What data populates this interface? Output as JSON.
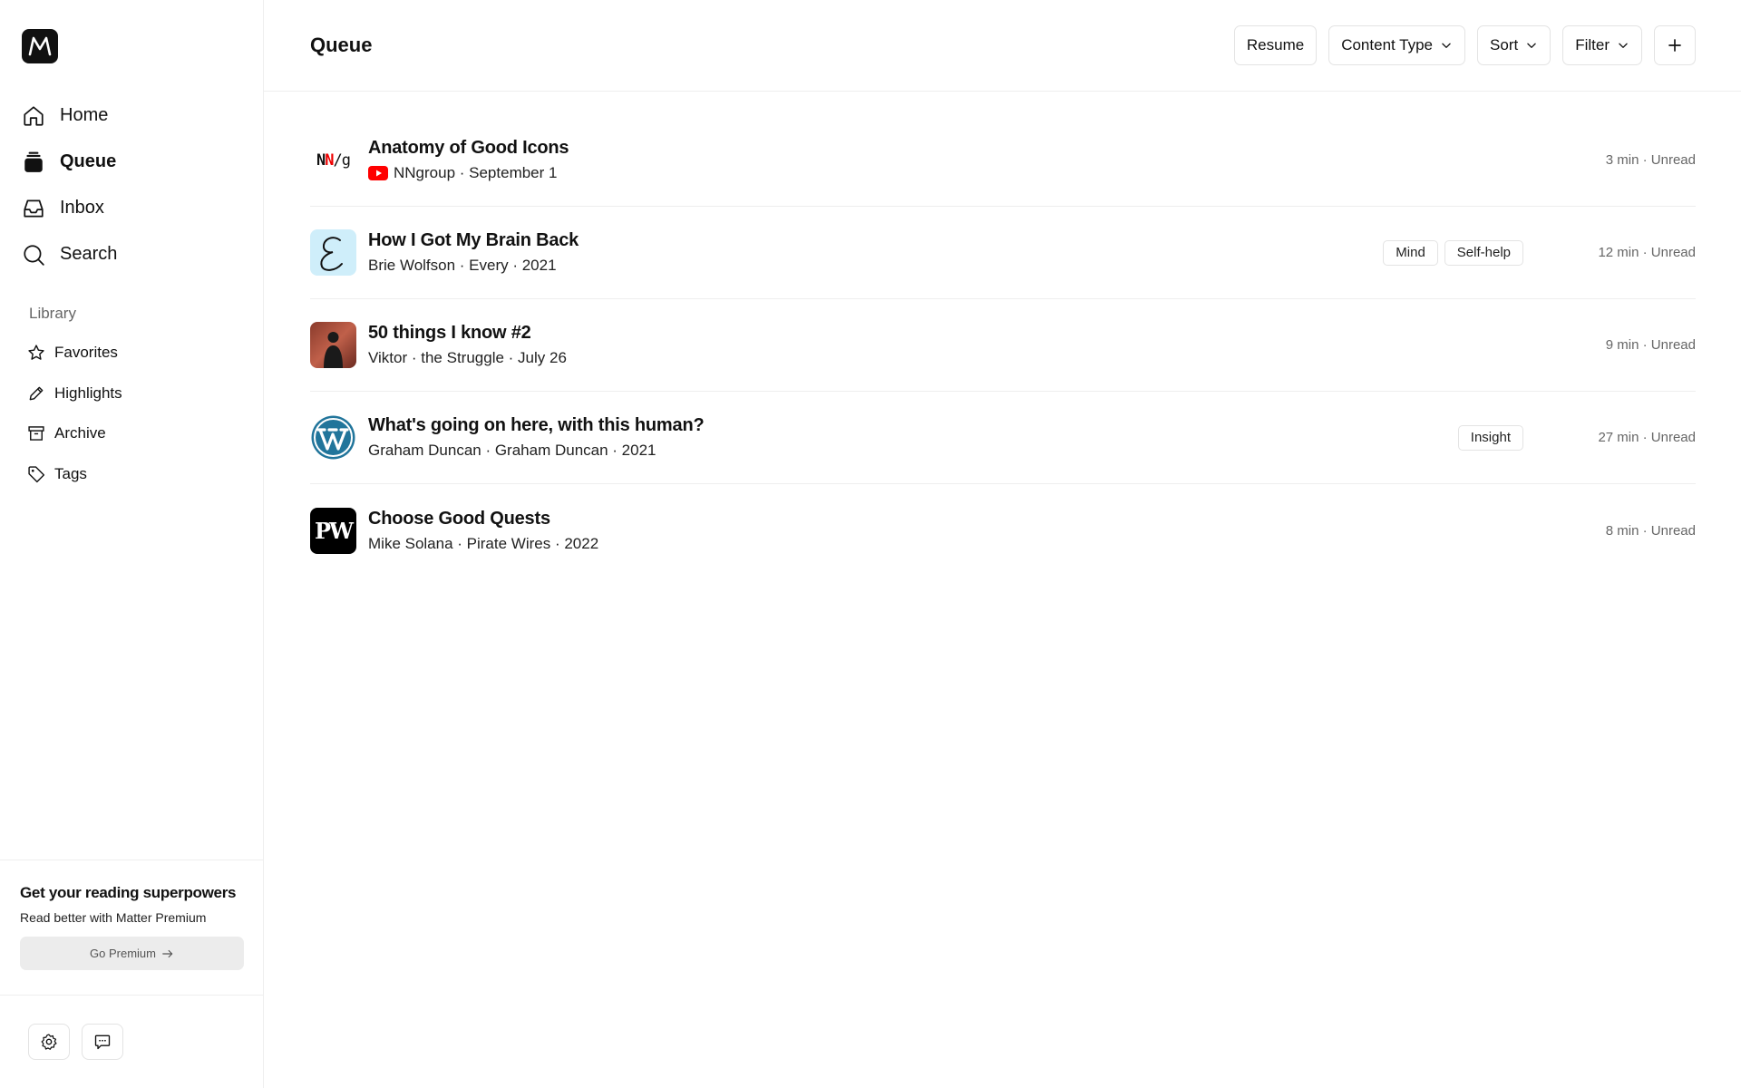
{
  "sidebar": {
    "nav": [
      {
        "label": "Home",
        "icon": "home-icon"
      },
      {
        "label": "Queue",
        "icon": "queue-icon",
        "active": true
      },
      {
        "label": "Inbox",
        "icon": "inbox-icon"
      },
      {
        "label": "Search",
        "icon": "search-icon"
      }
    ],
    "library_title": "Library",
    "library": [
      {
        "label": "Favorites",
        "icon": "star-icon"
      },
      {
        "label": "Highlights",
        "icon": "pencil-icon"
      },
      {
        "label": "Archive",
        "icon": "archive-icon"
      },
      {
        "label": "Tags",
        "icon": "tag-icon"
      }
    ],
    "promo": {
      "title": "Get your reading superpowers",
      "subtitle": "Read better with Matter Premium",
      "button": "Go Premium"
    }
  },
  "header": {
    "title": "Queue",
    "resume": "Resume",
    "content_type": "Content Type",
    "sort": "Sort",
    "filter": "Filter"
  },
  "items": [
    {
      "title": "Anatomy of Good Icons",
      "meta": "NNgroup · September 1",
      "tags": [],
      "status": "3 min · Unread"
    },
    {
      "title": "How I Got My Brain Back",
      "meta": "Brie Wolfson · Every · 2021",
      "tags": [
        "Mind",
        "Self-help"
      ],
      "status": "12 min · Unread"
    },
    {
      "title": "50 things I know #2",
      "meta": "Viktor · the Struggle · July 26",
      "tags": [],
      "status": "9 min · Unread"
    },
    {
      "title": "What's going on here, with this human?",
      "meta": "Graham Duncan · Graham Duncan · 2021",
      "tags": [
        "Insight"
      ],
      "status": "27 min · Unread"
    },
    {
      "title": "Choose Good Quests",
      "meta": "Mike Solana · Pirate Wires · 2022",
      "tags": [],
      "status": "8 min · Unread"
    }
  ],
  "thumbs": {
    "nng_text_1": "N",
    "nng_text_2": "N",
    "nng_text_3": "/g",
    "pw_text": "PW"
  },
  "colors": {
    "accent": "#111111",
    "youtube": "#ff0000",
    "wordpress": "#21759b",
    "every_bg": "#cfeefa"
  }
}
